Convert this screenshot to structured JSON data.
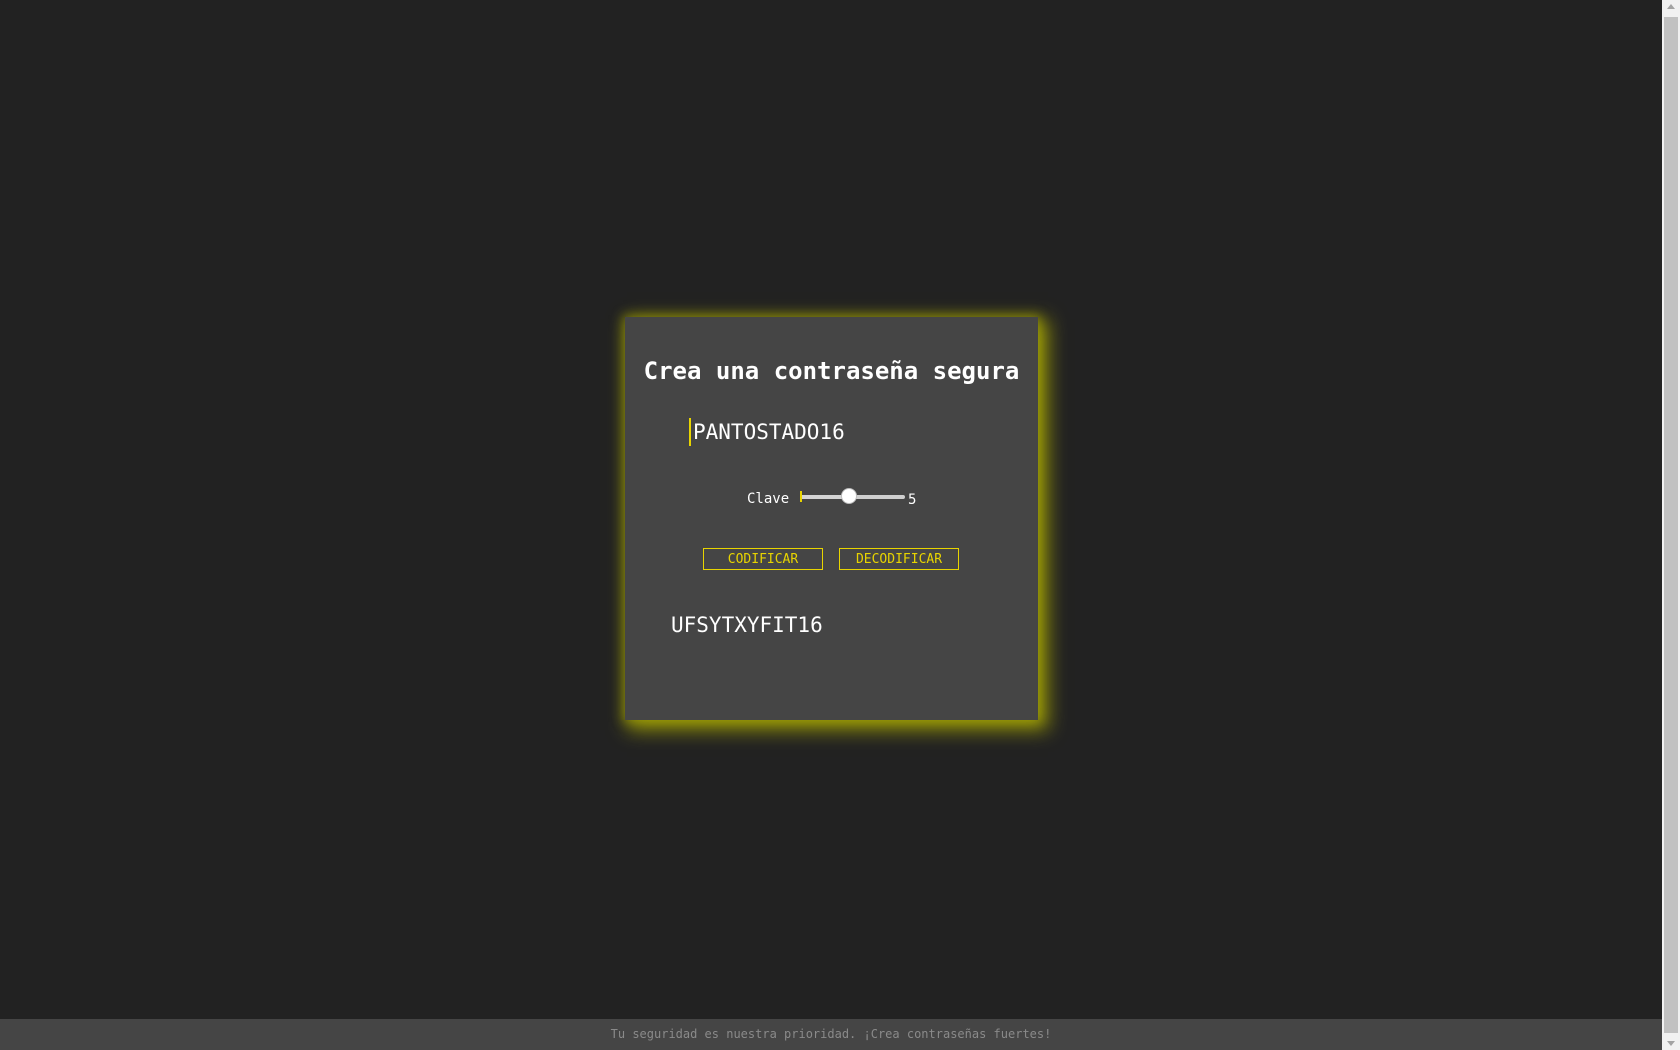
{
  "app": {
    "title": "Crea una contraseña segura",
    "input_value": "PANTOSTADO16",
    "key_label": "Clave",
    "key_value": "5",
    "slider": {
      "min": 0,
      "max": 10,
      "value": 5
    },
    "encode_label": "CODIFICAR",
    "decode_label": "DECODIFICAR",
    "result": "UFSYTXYFIT16"
  },
  "footer": {
    "text": "Tu seguridad es nuestra prioridad. ¡Crea contraseñas fuertes!"
  },
  "colors": {
    "background": "#222222",
    "card": "#454545",
    "accent": "#e8d400",
    "glow": "#b4b400"
  }
}
